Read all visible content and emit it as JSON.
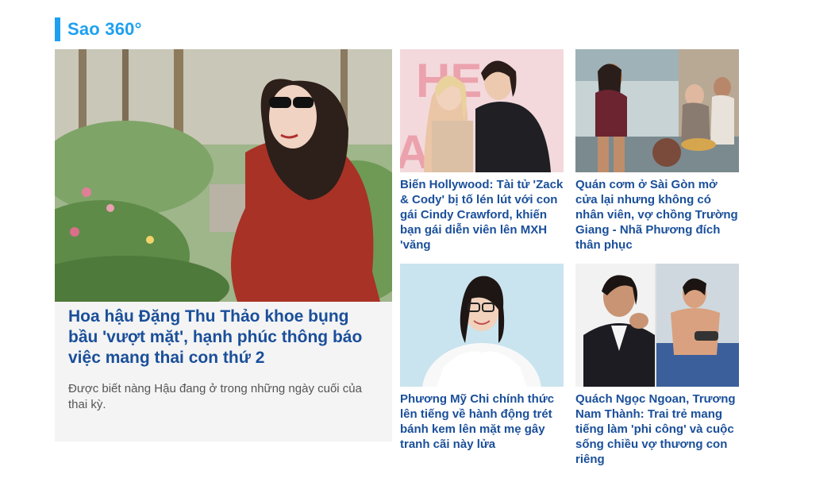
{
  "section": {
    "title": "Sao 360°",
    "accent_color": "#1ea0f0"
  },
  "featured": {
    "title": "Hoa hậu Đặng Thu Thảo khoe bụng bầu 'vượt mặt', hạnh phúc thông báo việc mang thai con thứ 2",
    "description": "Được biết nàng Hậu đang ở trong những ngày cuối của thai kỳ.",
    "title_color": "#1a4f9a"
  },
  "articles": [
    {
      "title": "Biến Hollywood: Tài tử 'Zack & Cody' bị tố lén lút với con gái Cindy Crawford, khiến bạn gái diễn viên lên MXH 'văng"
    },
    {
      "title": "Quán cơm ở Sài Gòn mở cửa lại nhưng không có nhân viên, vợ chồng Trường Giang - Nhã Phương đích thân phục"
    },
    {
      "title": "Phương Mỹ Chi chính thức lên tiếng về hành động trét bánh kem lên mặt mẹ gây tranh cãi này lửa"
    },
    {
      "title": "Quách Ngọc Ngoan, Trương Nam Thành: Trai trẻ mang tiếng làm 'phi công' và cuộc sống chiều vợ thương con riêng"
    }
  ]
}
